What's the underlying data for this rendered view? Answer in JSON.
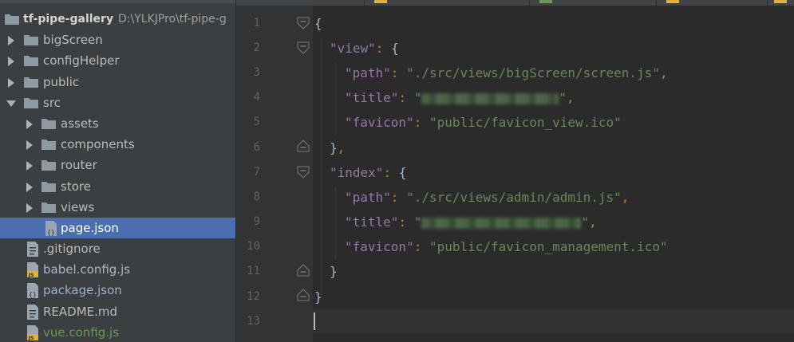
{
  "project": {
    "root": {
      "name": "tf-pipe-gallery",
      "path": "D:\\YLKJPro\\tf-pipe-g"
    },
    "items": [
      {
        "label": "bigScreen",
        "kind": "folder",
        "depth": 0,
        "expanded": false
      },
      {
        "label": "configHelper",
        "kind": "folder",
        "depth": 0,
        "expanded": false
      },
      {
        "label": "public",
        "kind": "folder",
        "depth": 0,
        "expanded": false
      },
      {
        "label": "src",
        "kind": "folder",
        "depth": 0,
        "expanded": true
      },
      {
        "label": "assets",
        "kind": "folder",
        "depth": 1,
        "expanded": false
      },
      {
        "label": "components",
        "kind": "folder",
        "depth": 1,
        "expanded": false
      },
      {
        "label": "router",
        "kind": "folder",
        "depth": 1,
        "expanded": false
      },
      {
        "label": "store",
        "kind": "folder",
        "depth": 1,
        "expanded": false
      },
      {
        "label": "views",
        "kind": "folder",
        "depth": 1,
        "expanded": false
      },
      {
        "label": "page.json",
        "kind": "json-file",
        "depth": 1,
        "selected": true
      },
      {
        "label": ".gitignore",
        "kind": "text-file",
        "depth": 0
      },
      {
        "label": "babel.config.js",
        "kind": "js-file",
        "depth": 0
      },
      {
        "label": "package.json",
        "kind": "json-file",
        "depth": 0
      },
      {
        "label": "README.md",
        "kind": "text-file",
        "depth": 0
      },
      {
        "label": "vue.config.js",
        "kind": "js-file",
        "depth": 0
      }
    ]
  },
  "colors": {
    "sidebar_bg": "#3c3f41",
    "selection": "#4b6eaf",
    "editor_bg": "#2b2b2b",
    "gutter_bg": "#313335",
    "key": "#9876aa",
    "string": "#6a8759",
    "punctuation": "#cc7832",
    "js_badge": "#e0b13e",
    "json_badge": "#9aa7b0",
    "folder": "#8e9aa3"
  },
  "icons": {
    "folder": "folder-icon",
    "js": "js-file-icon",
    "json": "json-file-icon",
    "text": "text-file-icon",
    "collapsed": "chevron-right-icon",
    "expanded": "chevron-down-icon"
  },
  "editor": {
    "line_numbers": [
      "1",
      "2",
      "3",
      "4",
      "5",
      "6",
      "7",
      "8",
      "9",
      "10",
      "11",
      "12",
      "13"
    ],
    "code": {
      "l1_open": "{",
      "l2_key": "\"view\"",
      "l2_colon": ":",
      "l2_open": " {",
      "l3_key": "\"path\"",
      "l3_colon": ": ",
      "l3_val": "\"./src/views/bigScreen/screen.js\"",
      "l3_comma": ",",
      "l4_key": "\"title\"",
      "l4_colon": ": ",
      "l4_quote_open": "\"",
      "l4_quote_close": "\"",
      "l4_comma": ",",
      "l5_key": "\"favicon\"",
      "l5_colon": ": ",
      "l5_val": "\"public/favicon_view.ico\"",
      "l6_close": "}",
      "l6_comma": ",",
      "l7_key": "\"index\"",
      "l7_colon": ":",
      "l7_open": " {",
      "l8_key": "\"path\"",
      "l8_colon": ": ",
      "l8_val": "\"./src/views/admin/admin.js\"",
      "l8_comma": ",",
      "l9_key": "\"title\"",
      "l9_colon": ": ",
      "l9_quote_open": "\"",
      "l9_quote_close": "\"",
      "l9_comma": ",",
      "l10_key": "\"favicon\"",
      "l10_colon": ": ",
      "l10_val": "\"public/favicon_management.ico\"",
      "l11_close": "}",
      "l12_close": "}"
    }
  }
}
